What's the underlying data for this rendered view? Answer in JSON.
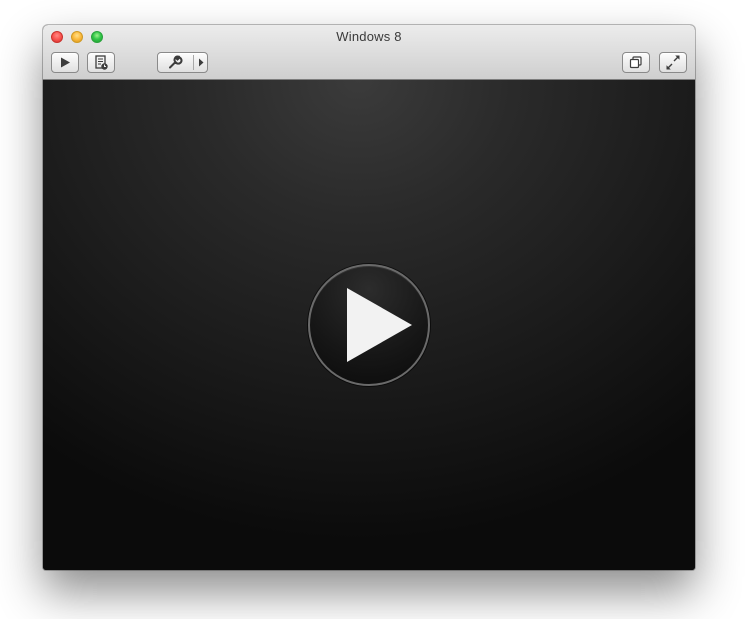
{
  "window": {
    "title": "Windows 8"
  },
  "toolbar": {
    "buttons": [
      {
        "name": "start-vm",
        "icon": "play-icon"
      },
      {
        "name": "snapshots",
        "icon": "snapshot-icon"
      },
      {
        "name": "settings",
        "icon": "wrench-icon"
      },
      {
        "name": "unity",
        "icon": "unity-windows-icon"
      },
      {
        "name": "fullscreen",
        "icon": "fullscreen-arrows-icon"
      }
    ]
  },
  "screen": {
    "overlay_icon": "large-play-icon"
  },
  "colors": {
    "close": "#fc5753",
    "minimize": "#fdbc40",
    "zoom": "#34c84a",
    "screen_dark": "#0b0b0b",
    "screen_light": "#3b3b3b",
    "play_glyph": "#f2f2f2"
  }
}
